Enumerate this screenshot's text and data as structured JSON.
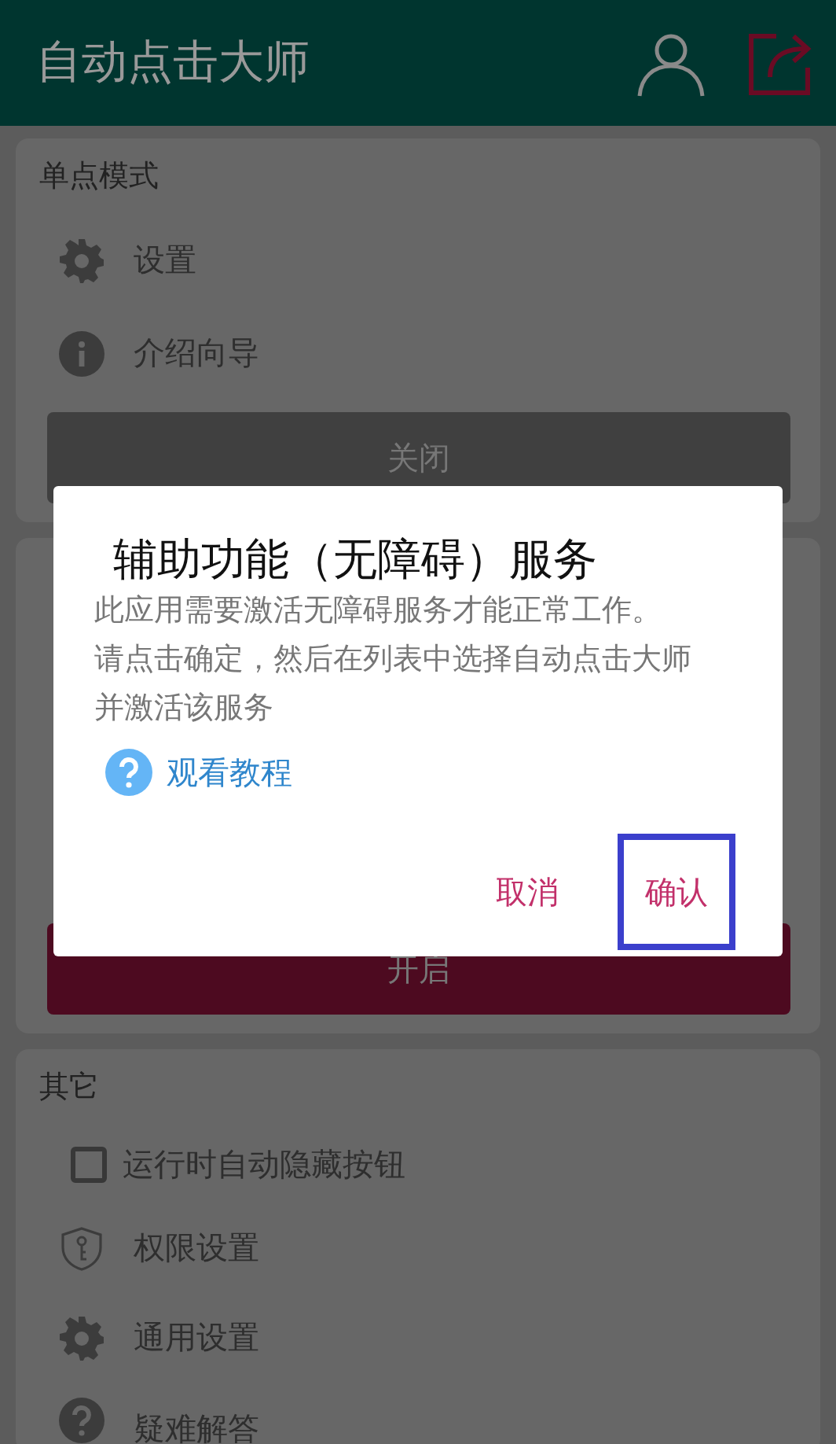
{
  "app_bar": {
    "title": "自动点击大师"
  },
  "cards": [
    {
      "title": "单点模式",
      "items": [
        {
          "kind": "gear",
          "label": "设置"
        },
        {
          "kind": "info",
          "label": "介绍向导"
        }
      ],
      "button": {
        "label": "关闭",
        "kind": "off"
      }
    },
    {
      "button": {
        "label": "开启",
        "kind": "on"
      }
    },
    {
      "title": "其它",
      "items": [
        {
          "kind": "checkbox",
          "label": "运行时自动隐藏按钮",
          "checked": false
        },
        {
          "kind": "shield",
          "label": "权限设置"
        },
        {
          "kind": "gear",
          "label": "通用设置"
        },
        {
          "kind": "help",
          "label": "疑难解答"
        }
      ]
    }
  ],
  "dialog": {
    "title": "辅助功能（无障碍）服务",
    "message": [
      "此应用需要激活无障碍服务才能正常工作。",
      "请点击确定，然后在列表中选择自动点击大师并激活该服务"
    ],
    "link": "观看教程",
    "buttons": [
      {
        "label": "取消",
        "focused": false
      },
      {
        "label": "确认",
        "focused": true
      }
    ]
  }
}
